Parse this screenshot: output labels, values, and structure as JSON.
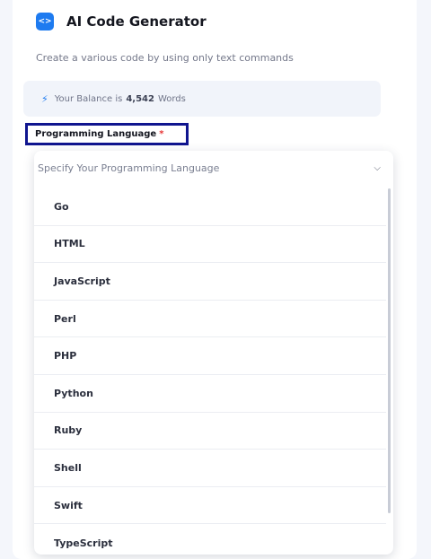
{
  "header": {
    "title": "AI Code Generator",
    "subtitle": "Create a various code by using only text commands",
    "logo_icon": "code-icon"
  },
  "balance": {
    "prefix": "Your Balance is",
    "amount": "4,542",
    "suffix": "Words",
    "icon": "lightning-icon"
  },
  "field": {
    "label": "Programming Language",
    "required_mark": "*",
    "placeholder": "Specify Your Programming Language"
  },
  "options": [
    "Go",
    "HTML",
    "JavaScript",
    "Perl",
    "PHP",
    "Python",
    "Ruby",
    "Shell",
    "Swift",
    "TypeScript"
  ],
  "colors": {
    "accent": "#1e7bf0",
    "highlight_border": "#10158f",
    "required": "#e63535"
  }
}
